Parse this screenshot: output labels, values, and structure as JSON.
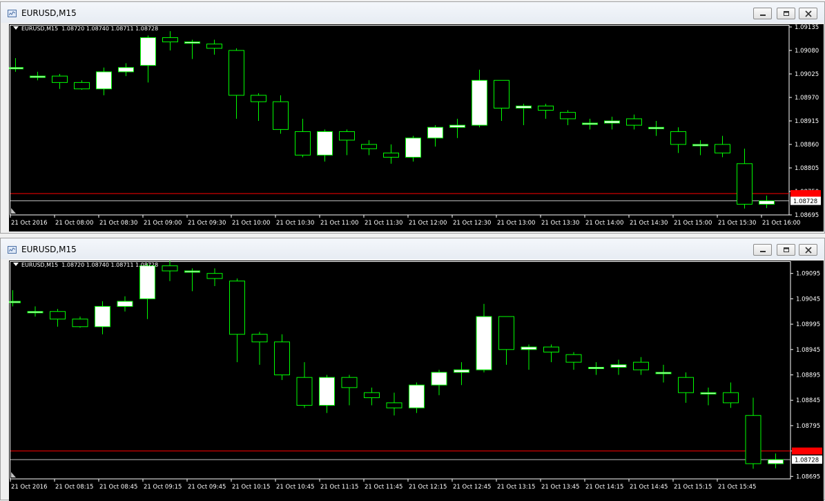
{
  "windows": [
    {
      "title": "EURUSD,M15",
      "info": "EURUSD,M15  1.08720 1.08740 1.08711 1.08728",
      "price_labels": [
        "1.09135",
        "1.09080",
        "1.09025",
        "1.08970",
        "1.08915",
        "1.08860",
        "1.08805",
        "1.08750",
        "1.08695"
      ],
      "current_price_label": "1.08728",
      "time_labels": [
        "21 Oct 2016",
        "21 Oct 08:00",
        "21 Oct 08:30",
        "21 Oct 09:00",
        "21 Oct 09:30",
        "21 Oct 10:00",
        "21 Oct 10:30",
        "21 Oct 11:00",
        "21 Oct 11:30",
        "21 Oct 12:00",
        "21 Oct 12:30",
        "21 Oct 13:00",
        "21 Oct 13:30",
        "21 Oct 14:00",
        "21 Oct 14:30",
        "21 Oct 15:00",
        "21 Oct 15:30",
        "21 Oct 16:00"
      ]
    },
    {
      "title": "EURUSD,M15",
      "info": "EURUSD,M15  1.08720 1.08740 1.08711 1.08728",
      "price_labels": [
        "1.09095",
        "1.09045",
        "1.08995",
        "1.08945",
        "1.08895",
        "1.08845",
        "1.08795",
        "1.08745",
        "1.08695"
      ],
      "current_price_label": "1.08728",
      "time_labels": [
        "21 Oct 2016",
        "21 Oct 08:15",
        "21 Oct 08:45",
        "21 Oct 09:15",
        "21 Oct 09:45",
        "21 Oct 10:15",
        "21 Oct 10:45",
        "21 Oct 11:15",
        "21 Oct 11:45",
        "21 Oct 12:15",
        "21 Oct 12:45",
        "21 Oct 13:15",
        "21 Oct 13:45",
        "21 Oct 14:15",
        "21 Oct 14:45",
        "21 Oct 15:15",
        "21 Oct 15:45"
      ]
    }
  ],
  "candles": [
    {
      "o": 1.0904,
      "h": 1.09062,
      "l": 1.0903,
      "c": 1.0904
    },
    {
      "o": 1.0902,
      "h": 1.0903,
      "l": 1.0901,
      "c": 1.0902
    },
    {
      "o": 1.0902,
      "h": 1.09025,
      "l": 1.0899,
      "c": 1.09005
    },
    {
      "o": 1.09005,
      "h": 1.0901,
      "l": 1.08988,
      "c": 1.0899
    },
    {
      "o": 1.0899,
      "h": 1.0904,
      "l": 1.08975,
      "c": 1.0903
    },
    {
      "o": 1.0903,
      "h": 1.0905,
      "l": 1.0902,
      "c": 1.0904
    },
    {
      "o": 1.09045,
      "h": 1.09115,
      "l": 1.09005,
      "c": 1.0911
    },
    {
      "o": 1.0911,
      "h": 1.09125,
      "l": 1.0908,
      "c": 1.091
    },
    {
      "o": 1.091,
      "h": 1.09105,
      "l": 1.0906,
      "c": 1.091
    },
    {
      "o": 1.09095,
      "h": 1.09105,
      "l": 1.0907,
      "c": 1.09085
    },
    {
      "o": 1.0908,
      "h": 1.09085,
      "l": 1.0892,
      "c": 1.08975
    },
    {
      "o": 1.08975,
      "h": 1.0898,
      "l": 1.08915,
      "c": 1.0896
    },
    {
      "o": 1.0896,
      "h": 1.08975,
      "l": 1.08885,
      "c": 1.08895
    },
    {
      "o": 1.0889,
      "h": 1.0892,
      "l": 1.0883,
      "c": 1.08835
    },
    {
      "o": 1.08835,
      "h": 1.08895,
      "l": 1.0882,
      "c": 1.0889
    },
    {
      "o": 1.0889,
      "h": 1.08895,
      "l": 1.08835,
      "c": 1.0887
    },
    {
      "o": 1.0886,
      "h": 1.0887,
      "l": 1.08835,
      "c": 1.0885
    },
    {
      "o": 1.0884,
      "h": 1.0886,
      "l": 1.08815,
      "c": 1.0883
    },
    {
      "o": 1.0883,
      "h": 1.0888,
      "l": 1.0882,
      "c": 1.08875
    },
    {
      "o": 1.08875,
      "h": 1.08905,
      "l": 1.08855,
      "c": 1.089
    },
    {
      "o": 1.089,
      "h": 1.0892,
      "l": 1.08875,
      "c": 1.08905
    },
    {
      "o": 1.08905,
      "h": 1.09035,
      "l": 1.089,
      "c": 1.0901
    },
    {
      "o": 1.0901,
      "h": 1.0901,
      "l": 1.08915,
      "c": 1.08945
    },
    {
      "o": 1.08945,
      "h": 1.08955,
      "l": 1.08905,
      "c": 1.0895
    },
    {
      "o": 1.0895,
      "h": 1.08955,
      "l": 1.0892,
      "c": 1.0894
    },
    {
      "o": 1.08935,
      "h": 1.0894,
      "l": 1.08905,
      "c": 1.0892
    },
    {
      "o": 1.0891,
      "h": 1.0892,
      "l": 1.08895,
      "c": 1.0891
    },
    {
      "o": 1.0891,
      "h": 1.08925,
      "l": 1.08895,
      "c": 1.08915
    },
    {
      "o": 1.0892,
      "h": 1.0893,
      "l": 1.08895,
      "c": 1.08905
    },
    {
      "o": 1.089,
      "h": 1.08915,
      "l": 1.0888,
      "c": 1.089
    },
    {
      "o": 1.0889,
      "h": 1.089,
      "l": 1.0884,
      "c": 1.0886
    },
    {
      "o": 1.0886,
      "h": 1.0887,
      "l": 1.08835,
      "c": 1.0886
    },
    {
      "o": 1.0886,
      "h": 1.0888,
      "l": 1.0883,
      "c": 1.0884
    },
    {
      "o": 1.08815,
      "h": 1.0885,
      "l": 1.0871,
      "c": 1.0872
    },
    {
      "o": 1.0872,
      "h": 1.0874,
      "l": 1.08711,
      "c": 1.08728
    }
  ],
  "colors": {
    "background": "#000000",
    "frame": "#ffffff",
    "candle_outline": "#00ff00",
    "bull_body": "#ffffff",
    "bear_body": "#000000",
    "ask_line": "#ff0000",
    "bid_line": "#c0c0c0",
    "current_label_bg": "#ffffff",
    "ask_label_bg": "#ff0000"
  }
}
